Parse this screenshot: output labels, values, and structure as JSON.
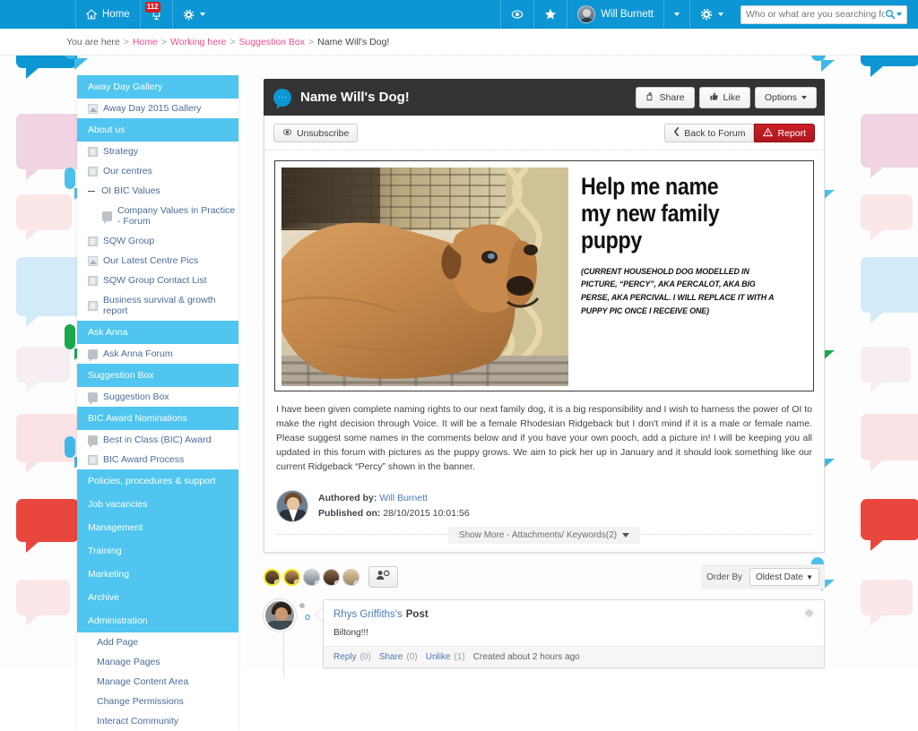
{
  "topbar": {
    "home_label": "Home",
    "notifications_badge": "112",
    "user_name": "Will Burnett",
    "search_placeholder": "Who or what are you searching for?...",
    "search_value": "",
    "icons": {
      "home": "home-icon",
      "notifications": "notifications-icon",
      "settings": "gear-icon",
      "eye": "eye-icon",
      "star": "star-icon",
      "admin_gear": "gear-icon",
      "search": "search-icon"
    },
    "brand_color": "#0c96d4"
  },
  "breadcrumb": {
    "prefix": "You are here",
    "items": [
      {
        "label": "Home",
        "link": true
      },
      {
        "label": "Working here",
        "link": true
      },
      {
        "label": "Suggestion Box",
        "link": true
      },
      {
        "label": "Name Will's Dog!",
        "link": false
      }
    ],
    "separator": ">",
    "link_color": "#ef4e8c"
  },
  "sidebar": {
    "accent": "#4fc5ef",
    "items": [
      {
        "label": "Away Day Gallery",
        "type": "header"
      },
      {
        "label": "Away Day 2015 Gallery",
        "type": "link",
        "icon": "image-icon"
      },
      {
        "label": "About us",
        "type": "header"
      },
      {
        "label": "Strategy",
        "type": "link",
        "icon": "document-icon"
      },
      {
        "label": "Our centres",
        "type": "link",
        "icon": "document-icon"
      },
      {
        "label": "OI BIC Values",
        "type": "link",
        "icon": "minus-icon"
      },
      {
        "label": "Company Values in Practice - Forum",
        "type": "link-indent",
        "icon": "forum-icon"
      },
      {
        "label": "SQW Group",
        "type": "link",
        "icon": "document-icon"
      },
      {
        "label": "Our Latest Centre Pics",
        "type": "link",
        "icon": "image-icon"
      },
      {
        "label": "SQW Group Contact List",
        "type": "link",
        "icon": "document-icon"
      },
      {
        "label": "Business survival & growth report",
        "type": "link",
        "icon": "document-icon"
      },
      {
        "label": "Ask Anna",
        "type": "header"
      },
      {
        "label": "Ask Anna Forum",
        "type": "link",
        "icon": "forum-icon"
      },
      {
        "label": "Suggestion Box",
        "type": "header"
      },
      {
        "label": "Suggestion Box",
        "type": "link",
        "icon": "forum-icon"
      },
      {
        "label": "BIC Award Nominations",
        "type": "header"
      },
      {
        "label": "Best in Class (BIC) Award",
        "type": "link",
        "icon": "forum-icon"
      },
      {
        "label": "BIC Award Process",
        "type": "link",
        "icon": "document-icon"
      },
      {
        "label": "Policies, procedures & support",
        "type": "header"
      },
      {
        "label": "Job vacancies",
        "type": "header"
      },
      {
        "label": "Management",
        "type": "header"
      },
      {
        "label": "Training",
        "type": "header"
      },
      {
        "label": "Marketing",
        "type": "header"
      },
      {
        "label": "Archive",
        "type": "header"
      },
      {
        "label": "Administration",
        "type": "header"
      },
      {
        "label": "Add Page",
        "type": "sub"
      },
      {
        "label": "Manage Pages",
        "type": "sub"
      },
      {
        "label": "Manage Content Area",
        "type": "sub"
      },
      {
        "label": "Change Permissions",
        "type": "sub"
      },
      {
        "label": "Interact Community",
        "type": "sub"
      }
    ]
  },
  "main": {
    "title": "Name Will's Dog!",
    "head_buttons": [
      {
        "label": "Share",
        "icon": "share-icon"
      },
      {
        "label": "Like",
        "icon": "thumbs-up-icon"
      },
      {
        "label": "Options",
        "icon": "caret-down-icon"
      }
    ],
    "toolbar": {
      "unsubscribe_label": "Unsubscribe",
      "back_label": "Back to Forum",
      "report_label": "Report"
    },
    "poster": {
      "heading_lines": [
        "Help me name",
        "my new family",
        "puppy"
      ],
      "subtext": "(CURRENT HOUSEHOLD DOG MODELLED IN PICTURE, “PERCY”, AKA PERCALOT, AKA BIG PERSE, AKA PERCIVAL. I WILL REPLACE IT WITH A PUPPY PIC ONCE I RECEIVE ONE)",
      "photo_alt": "dog-photo"
    },
    "body_text": "I have been given complete naming rights to our next family dog, it is a big responsibility and I wish to harness the power of OI to make the right decision through Voice. It will be a female Rhodesian Ridgeback but I don't mind if it is a male or female name. Please suggest some names in the comments below and if you have your own pooch, add a picture in! I will be keeping you all updated in this forum with pictures as the puppy grows. We aim to pick her up in January and it should look something like our current Ridgeback “Percy” shown in the banner.",
    "author": {
      "authored_label": "Authored by:",
      "author_name": "Will Burnett",
      "published_label": "Published on:",
      "published_date": "28/10/2015 10:01:56"
    },
    "show_more_label": "Show More - Attachments/ Keywords(2)"
  },
  "comments": {
    "order_by_label": "Order By",
    "order_by_value": "Oldest Date",
    "people_button": "people-icon",
    "list": [
      {
        "author": "Rhys Griffiths's",
        "title_suffix": "Post",
        "text": "Biltong!!!",
        "reply_label": "Reply",
        "reply_count": "(0)",
        "share_label": "Share",
        "share_count": "(0)",
        "like_label": "Unlike",
        "like_count": "(1)",
        "timestamp": "Created about 2 hours ago"
      }
    ]
  }
}
